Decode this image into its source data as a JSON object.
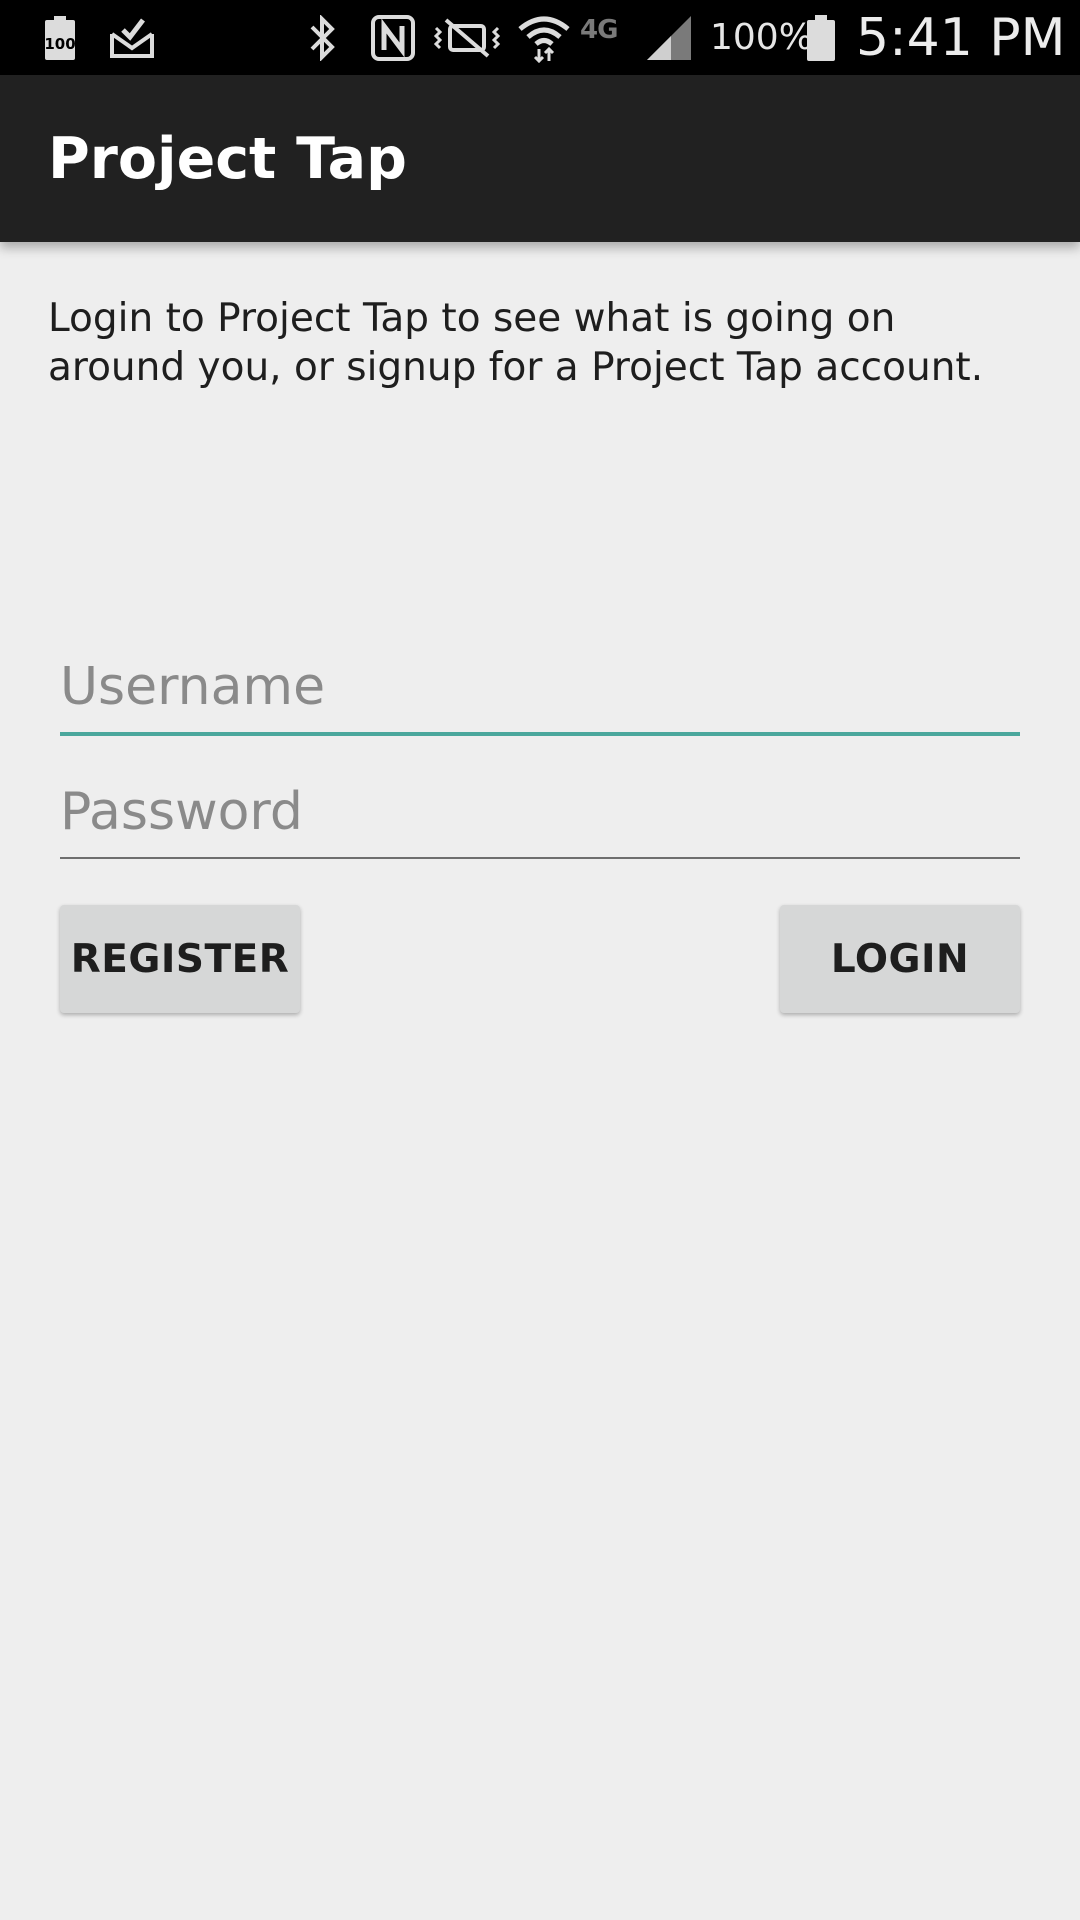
{
  "status_bar": {
    "battery_small_label": "100",
    "battery_percent": "100%",
    "network_label": "4G",
    "time": "5:41 PM",
    "icons": [
      "battery-saver-icon",
      "mail-check-icon",
      "bluetooth-icon",
      "nfc-icon",
      "vibrate-mute-icon",
      "wifi-icon",
      "lte-icon",
      "signal-icon",
      "battery-icon"
    ]
  },
  "app_bar": {
    "title": "Project Tap"
  },
  "login": {
    "intro": "Login to Project Tap to see what is going on around you, or signup for a Project Tap account.",
    "username_placeholder": "Username",
    "password_placeholder": "Password",
    "register_label": "REGISTER",
    "login_label": "LOGIN"
  },
  "colors": {
    "app_bar_bg": "#212121",
    "status_bar_bg": "#000000",
    "page_bg": "#eeeeee",
    "accent": "#4aa79c",
    "button_bg": "#d6d7d7"
  }
}
